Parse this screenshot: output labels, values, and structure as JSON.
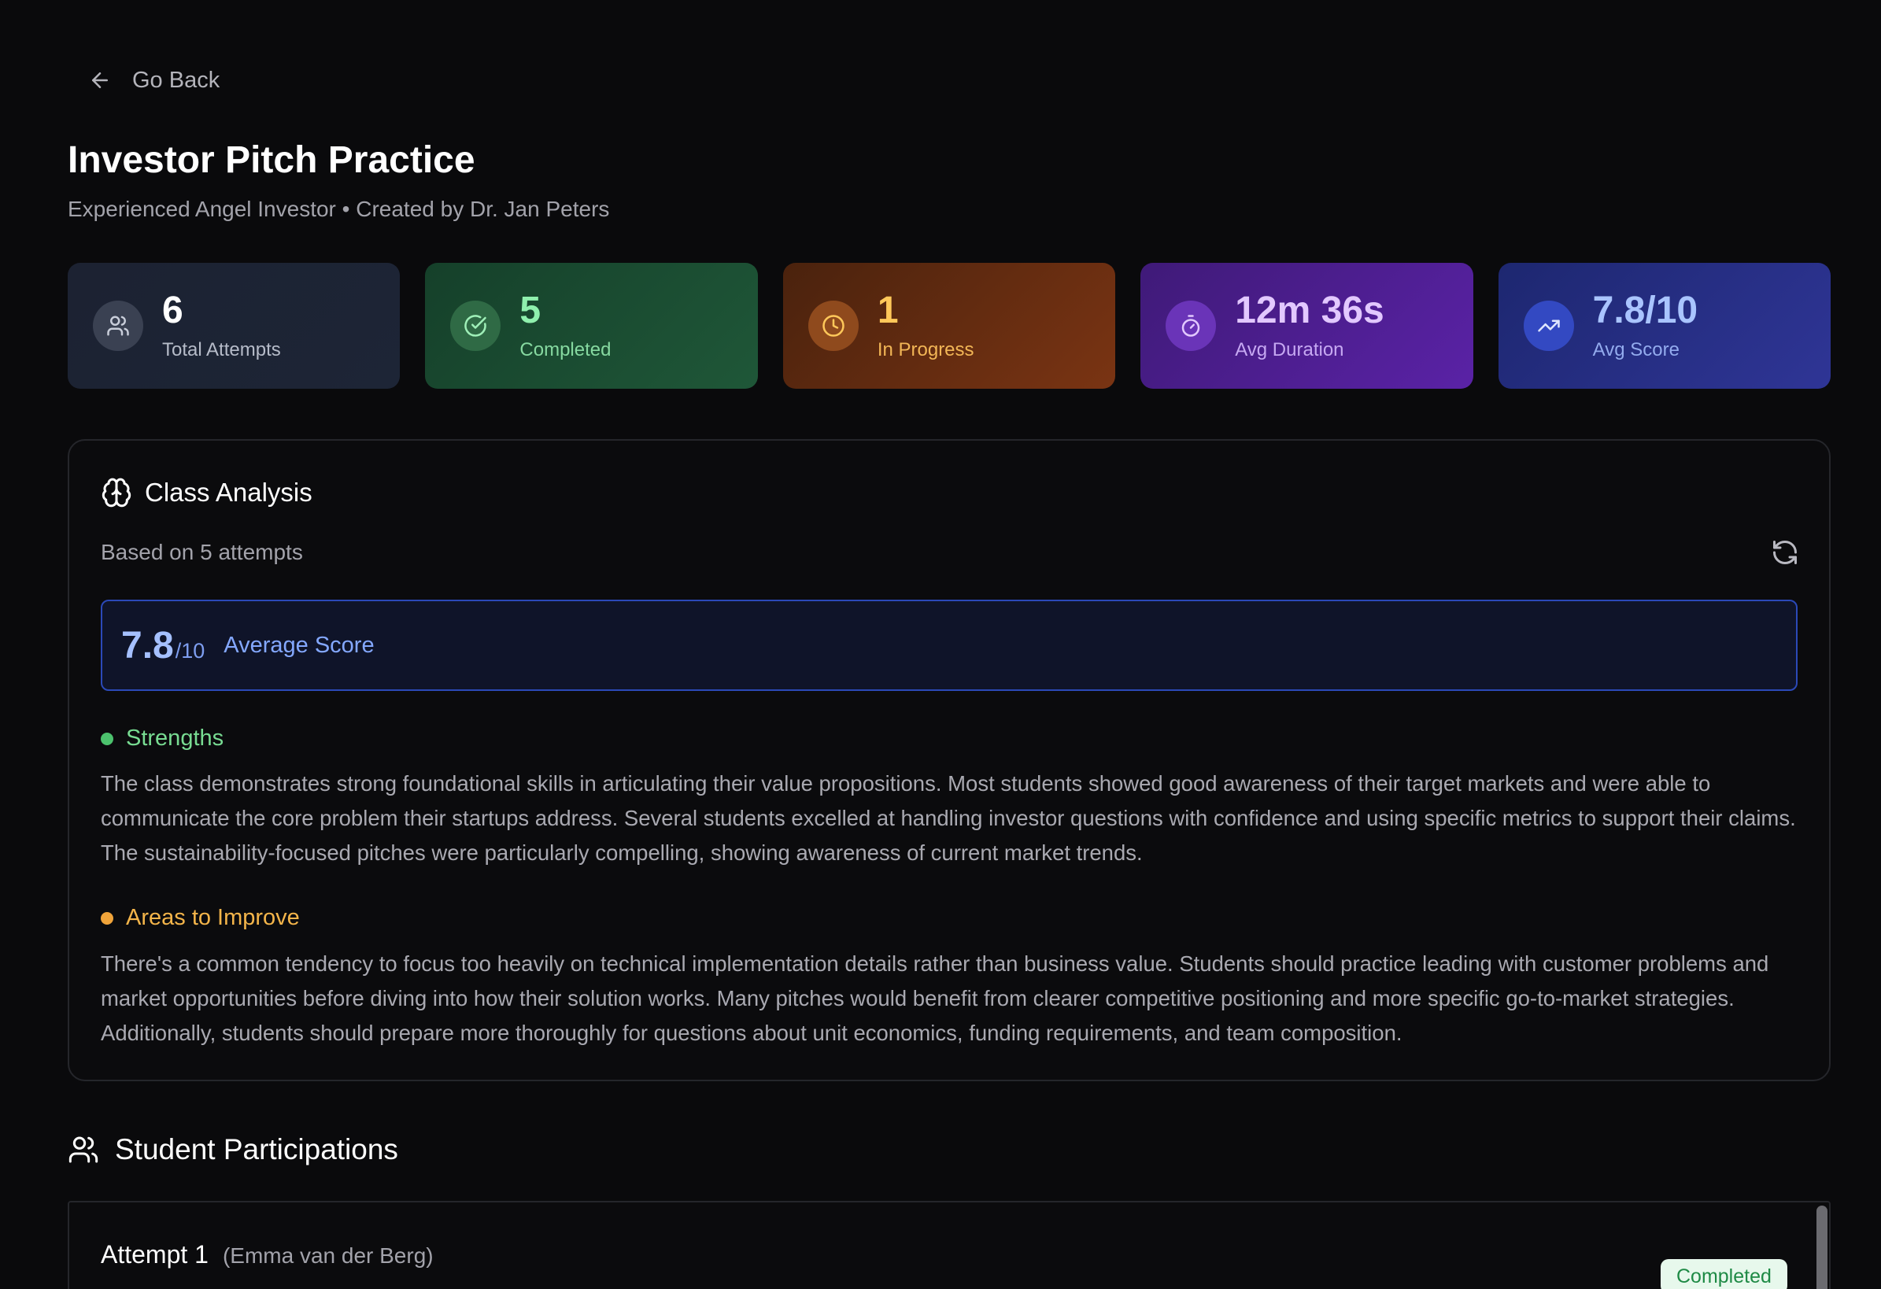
{
  "nav": {
    "back_label": "Go Back"
  },
  "header": {
    "title": "Investor Pitch Practice",
    "subtitle": "Experienced Angel Investor • Created by Dr. Jan Peters"
  },
  "stats": [
    {
      "value": "6",
      "label": "Total Attempts",
      "icon": "users-icon"
    },
    {
      "value": "5",
      "label": "Completed",
      "icon": "check-circle-icon"
    },
    {
      "value": "1",
      "label": "In Progress",
      "icon": "clock-icon"
    },
    {
      "value": "12m 36s",
      "label": "Avg Duration",
      "icon": "stopwatch-icon"
    },
    {
      "value": "7.8/10",
      "label": "Avg Score",
      "icon": "trending-up-icon"
    }
  ],
  "analysis": {
    "title": "Class Analysis",
    "subtitle": "Based on 5 attempts",
    "score": "7.8",
    "score_denominator": "/10",
    "score_label": "Average Score",
    "strengths_title": "Strengths",
    "strengths_text": "The class demonstrates strong foundational skills in articulating their value propositions. Most students showed good awareness of their target markets and were able to communicate the core problem their startups address. Several students excelled at handling investor questions with confidence and using specific metrics to support their claims. The sustainability-focused pitches were particularly compelling, showing awareness of current market trends.",
    "improve_title": "Areas to Improve",
    "improve_text": "There's a common tendency to focus too heavily on technical implementation details rather than business value. Students should practice leading with customer problems and market opportunities before diving into how their solution works. Many pitches would benefit from clearer competitive positioning and more specific go-to-market strategies. Additionally, students should prepare more thoroughly for questions about unit economics, funding requirements, and team composition."
  },
  "participations": {
    "title": "Student Participations",
    "attempts": [
      {
        "label": "Attempt 1",
        "student": "(Emma van der Berg)",
        "status": "Completed"
      }
    ]
  }
}
